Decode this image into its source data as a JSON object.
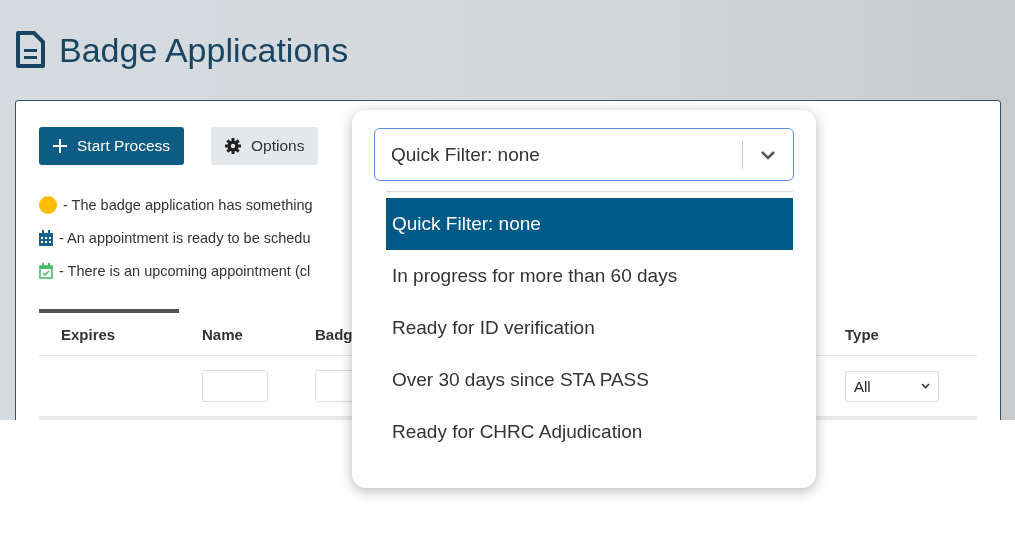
{
  "page": {
    "title": "Badge Applications"
  },
  "toolbar": {
    "buttons": [
      {
        "label": "Start Process",
        "kind": "primary"
      },
      {
        "label": "Options",
        "kind": "secondary"
      }
    ]
  },
  "legend": [
    {
      "kind": "dot",
      "color": "#fbbc05",
      "text": "- The badge application has something"
    },
    {
      "kind": "calendar",
      "color": "#1c5f8c",
      "text": "- An appointment is ready to be schedu"
    },
    {
      "kind": "calendar-check",
      "color": "#4cbb6c",
      "text": "- There is an upcoming appointment (cl"
    }
  ],
  "table": {
    "columns": [
      {
        "label": "Expires",
        "kind": "none"
      },
      {
        "label": "Name",
        "kind": "text"
      },
      {
        "label": "Badg",
        "kind": "text"
      },
      {
        "label": "Type",
        "kind": "select",
        "value": "All"
      }
    ]
  },
  "quick_filter": {
    "value": "Quick Filter: none",
    "options": [
      {
        "label": "Quick Filter: none",
        "selected": true
      },
      {
        "label": "In progress for more than 60 days",
        "selected": false
      },
      {
        "label": "Ready for ID verification",
        "selected": false
      },
      {
        "label": "Over 30 days since STA PASS",
        "selected": false
      },
      {
        "label": "Ready for CHRC Adjudication",
        "selected": false
      }
    ]
  }
}
